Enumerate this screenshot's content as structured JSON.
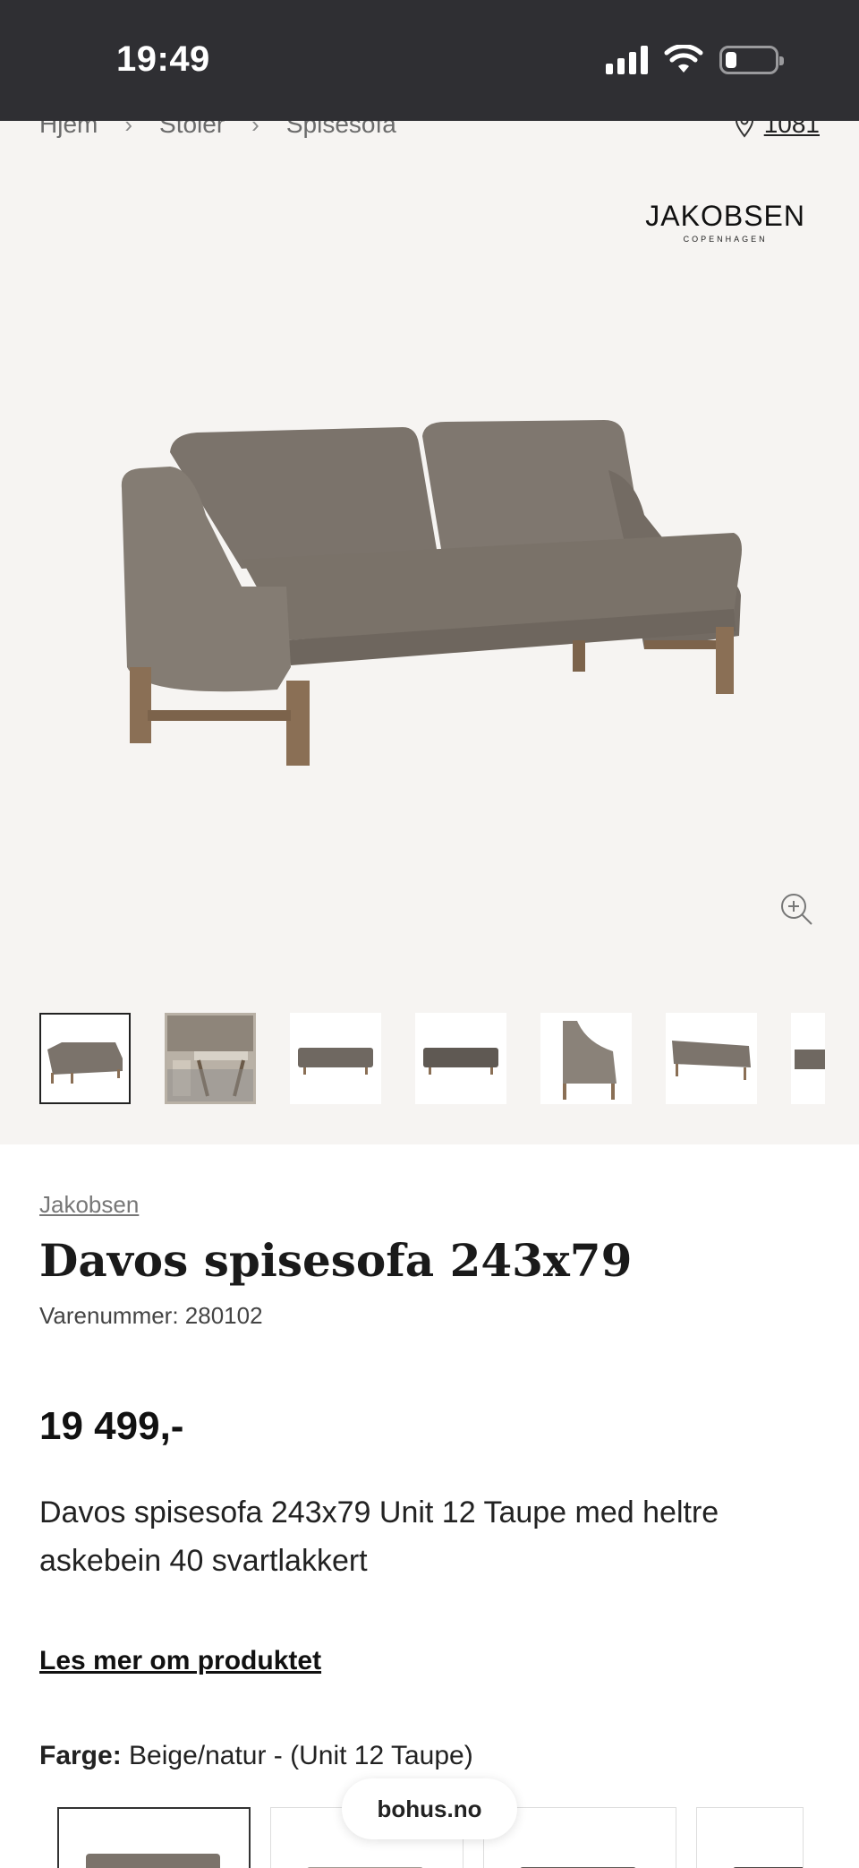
{
  "status_bar": {
    "time": "19:49"
  },
  "breadcrumb": {
    "items": [
      "Hjem",
      "Stoler",
      "Spisesofa"
    ]
  },
  "store": {
    "number": "1081"
  },
  "brand_logo": {
    "name": "JAKOBSEN",
    "tagline": "COPENHAGEN"
  },
  "product": {
    "brand": "Jakobsen",
    "title": "Davos spisesofa 243x79",
    "sku": "Varenummer: 280102",
    "price": "19 499,-",
    "description": "Davos spisesofa 243x79 Unit 12 Taupe med heltre askebein 40 svartlakkert",
    "read_more": "Les mer om produktet",
    "color_label": "Farge:",
    "color_value": "Beige/natur - (Unit 12 Taupe)"
  },
  "thumbnails": {
    "count": 7,
    "active_index": 0
  },
  "site_pill": "bohus.no",
  "colors": {
    "status_bar": "#2f2f33",
    "gallery_bg": "#f6f4f2",
    "sofa_fabric": "#7b736b",
    "wood": "#8a6f55"
  }
}
